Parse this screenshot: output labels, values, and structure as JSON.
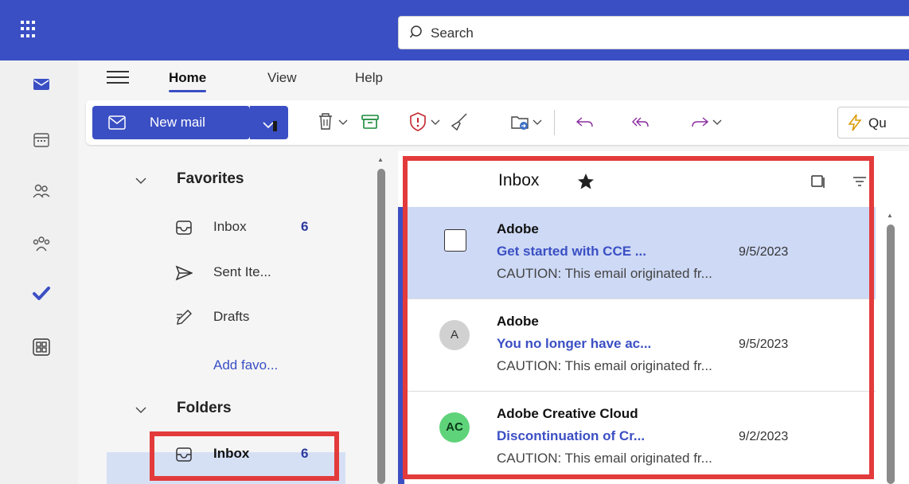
{
  "topbar": {
    "search_placeholder": "Search",
    "brand_color": "#3b4fc4"
  },
  "rail": {
    "items": [
      "mail-icon",
      "calendar-icon",
      "people-icon",
      "groups-icon",
      "todo-icon",
      "apps-icon"
    ]
  },
  "ribbon": {
    "tabs": [
      "Home",
      "View",
      "Help"
    ],
    "active_tab": "Home",
    "new_mail_label": "New mail",
    "quick_steps_label": "Qu"
  },
  "folders": {
    "favorites_label": "Favorites",
    "favorites": [
      {
        "label": "Inbox",
        "count": "6"
      },
      {
        "label": "Sent Ite...",
        "count": ""
      },
      {
        "label": "Drafts",
        "count": ""
      }
    ],
    "add_favorite_label": "Add favo...",
    "folders_label": "Folders",
    "folder_items": [
      {
        "label": "Inbox",
        "count": "6"
      }
    ]
  },
  "message_list": {
    "title": "Inbox",
    "messages": [
      {
        "sender": "Adobe",
        "subject": "Get started with CCE ...",
        "date": "9/5/2023",
        "preview": "CAUTION: This email originated fr...",
        "avatar": "",
        "selected": true
      },
      {
        "sender": "Adobe",
        "subject": "You no longer have ac...",
        "date": "9/5/2023",
        "preview": "CAUTION: This email originated fr...",
        "avatar": "A",
        "avatar_color": "#d1d1d1"
      },
      {
        "sender": "Adobe Creative Cloud",
        "subject": "Discontinuation of Cr...",
        "date": "9/2/2023",
        "preview": "CAUTION: This email originated fr...",
        "avatar": "AC",
        "avatar_color": "#5fd37a"
      }
    ]
  },
  "annotation_color": "#e33b3b"
}
